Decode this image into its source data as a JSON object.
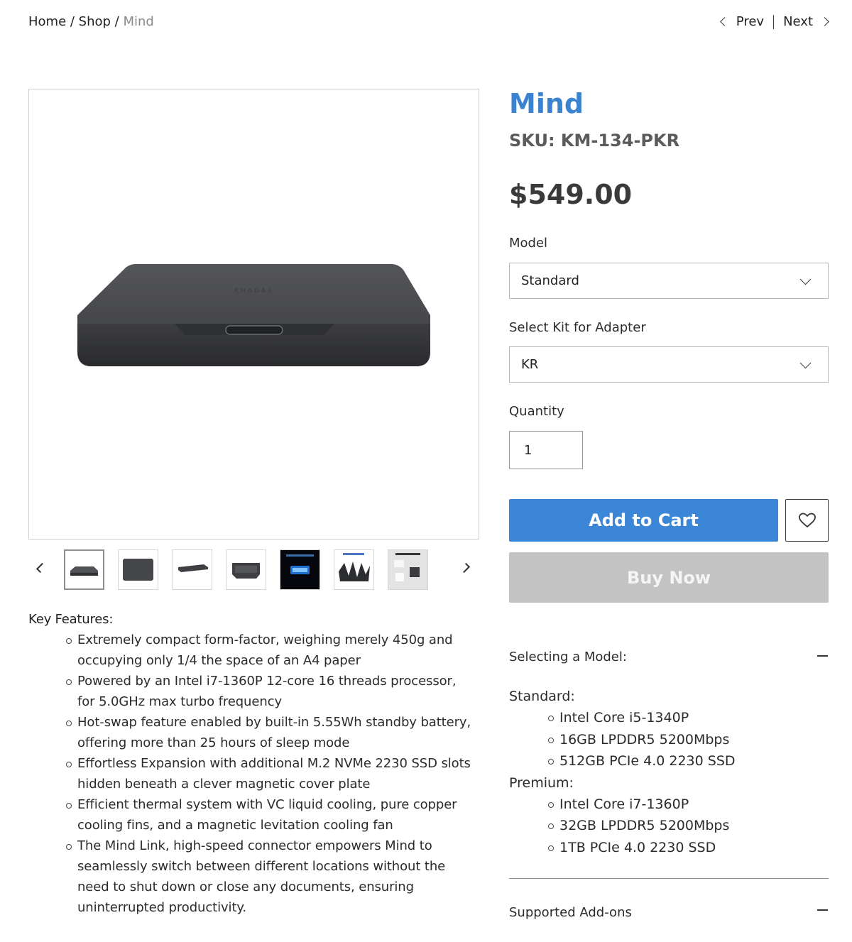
{
  "breadcrumb": {
    "home": "Home",
    "sep1": " / ",
    "shop": "Shop",
    "sep2": " / ",
    "current": "Mind"
  },
  "pager": {
    "prev": "Prev",
    "next": "Next"
  },
  "product": {
    "title": "Mind",
    "sku": "SKU: KM-134-PKR",
    "price": "$549.00"
  },
  "options": {
    "model_label": "Model",
    "model_value": "Standard",
    "kit_label": "Select Kit for Adapter",
    "kit_value": "KR",
    "quantity_label": "Quantity",
    "quantity_value": "1"
  },
  "actions": {
    "add_to_cart": "Add to Cart",
    "buy_now": "Buy Now"
  },
  "gallery": {
    "thumbnails": [
      "front-view",
      "top-view",
      "side-view",
      "rear-view",
      "standby-battery",
      "compact-body",
      "whats-in-the-box"
    ],
    "active_index": 0
  },
  "features": {
    "heading": "Key Features:",
    "items": [
      "Extremely compact form-factor, weighing merely 450g and occupying only 1/4 the space of an A4 paper",
      "Powered by an Intel i7-1360P 12-core 16 threads processor, for 5.0GHz max turbo frequency",
      "Hot-swap feature enabled by built-in 5.55Wh standby battery, offering more than 25 hours of sleep mode",
      "Effortless Expansion with additional M.2 NVMe 2230 SSD slots hidden beneath a clever magnetic cover plate",
      "Efficient thermal system with VC liquid cooling, pure copper cooling fins, and a magnetic levitation cooling fan",
      "The Mind Link, high-speed connector empowers Mind to seamlessly switch between different locations without the need to shut down or close any documents, ensuring uninterrupted productivity."
    ]
  },
  "accordion": {
    "selecting_title": "Selecting a Model:",
    "standard_label": "Standard:",
    "standard_items": [
      "Intel Core i5-1340P",
      "16GB LPDDR5 5200Mbps",
      "512GB PCIe 4.0 2230 SSD"
    ],
    "premium_label": "Premium:",
    "premium_items": [
      "Intel Core i7-1360P",
      "32GB LPDDR5 5200Mbps",
      "1TB PCIe 4.0 2230 SSD"
    ],
    "addons_title": "Supported Add-ons"
  },
  "colors": {
    "accent": "#3b86d6",
    "title": "#3b83d1",
    "disabled_button": "#c3c3c3"
  }
}
